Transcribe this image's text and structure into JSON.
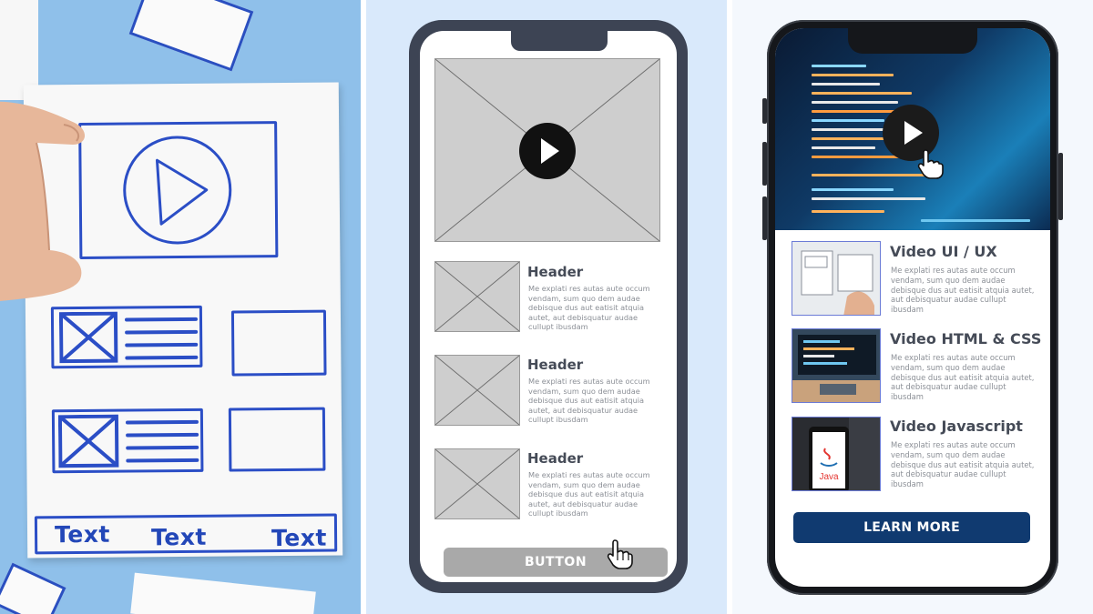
{
  "sketch": {
    "footer_texts": [
      "Text",
      "Text",
      "Text"
    ]
  },
  "wireframe": {
    "items": [
      {
        "header": "Header",
        "body": "Me explati res autas aute occum vendam, sum quo dem audae debisque dus aut eatisit atquia autet, aut debisquatur audae cullupt ibusdam"
      },
      {
        "header": "Header",
        "body": "Me explati res autas aute occum vendam, sum quo dem audae debisque dus aut eatisit atquia autet, aut debisquatur audae cullupt ibusdam"
      },
      {
        "header": "Header",
        "body": "Me explati res autas aute occum vendam, sum quo dem audae debisque dus aut eatisit atquia autet, aut debisquatur audae cullupt ibusdam"
      }
    ],
    "button_label": "BUTTON"
  },
  "app": {
    "videos": [
      {
        "title": "Video UI / UX",
        "body": "Me explati res autas aute occum vendam, sum quo dem audae debisque dus aut eatisit atquia autet, aut debisquatur audae cullupt ibusdam"
      },
      {
        "title": "Video HTML & CSS",
        "body": "Me explati res autas aute occum vendam, sum quo dem audae debisque dus aut eatisit atquia autet, aut debisquatur audae cullupt ibusdam"
      },
      {
        "title": "Video Javascript",
        "body": "Me explati res autas aute occum vendam, sum quo dem audae debisque dus aut eatisit atquia autet, aut debisquatur audae cullupt ibusdam"
      }
    ],
    "java_logo_text": "Java",
    "cta_label": "LEARN MORE",
    "colors": {
      "cta": "#103a70",
      "sketch_ink": "#2b4ec6",
      "wireframe_frame": "#3d4454"
    }
  }
}
